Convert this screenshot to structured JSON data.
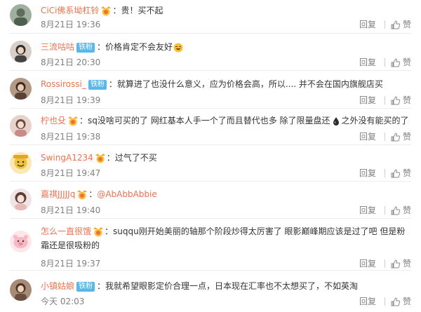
{
  "comments": [
    {
      "username": "CiCi佛系坳杠铃",
      "has_medal": true,
      "badge": "",
      "colon": "：",
      "text": "贵！买不起",
      "time": "8月21日 19:36",
      "reply": "回复",
      "like": "赞",
      "avatar_color": "#6a7b6a"
    },
    {
      "username": "三流咕咕",
      "badge": "铁粉",
      "colon": "：",
      "text": "价格肯定不会友好",
      "emoji": "laugh",
      "time": "8月21日 20:30",
      "reply": "回复",
      "like": "赞",
      "avatar_color": "#3a3a3a"
    },
    {
      "username": "Rossirossi_",
      "badge": "铁粉",
      "colon": "：",
      "text": "就算进了也没什么意义，应为价格会高，所以.... 并不会在国内旗舰店买",
      "time": "8月21日 19:39",
      "reply": "回复",
      "like": "赞",
      "avatar_color": "#7a5c4a"
    },
    {
      "username": "柠也殳",
      "has_medal": true,
      "colon": "：",
      "text_a": "sq没啥可买的了 网红基本人手一个了而且替代也多 除了限量盘还",
      "text_b": "之外没有能买的了",
      "emoji": "drop",
      "time": "8月21日 19:38",
      "reply": "回复",
      "like": "赞",
      "avatar_color": "#c9a6a0"
    },
    {
      "username": "SwingA1234",
      "has_medal": true,
      "colon": "：",
      "text": "过气了不买",
      "time": "8月21日 19:47",
      "reply": "回复",
      "like": "赞",
      "avatar_color": "#e8c460"
    },
    {
      "username": "嘉祺JJJJJq",
      "has_medal": true,
      "colon": "：",
      "mention": "@AbAbbAbbie",
      "time": "8月21日 19:40",
      "reply": "回复",
      "like": "赞",
      "avatar_color": "#d9b5b5"
    },
    {
      "username": "怎么一直很饿",
      "has_medal": true,
      "colon": "：",
      "text": "suqqu刚开始美丽的轴那个阶段炒得太厉害了 眼影巅峰期应该是过了吧 但是粉霜还是很吸粉的",
      "time": "8月21日 19:37",
      "reply": "回复",
      "like": "赞",
      "avatar_color": "#f3c6cc"
    },
    {
      "username": "小镇姑娘",
      "badge": "铁粉",
      "colon": "：",
      "text": "我就希望眼影定价合理一点，日本现在汇率也不太想买了，不如英淘",
      "time": "今天 02:03",
      "reply": "回复",
      "like": "赞",
      "avatar_color": "#8a6b55"
    }
  ]
}
